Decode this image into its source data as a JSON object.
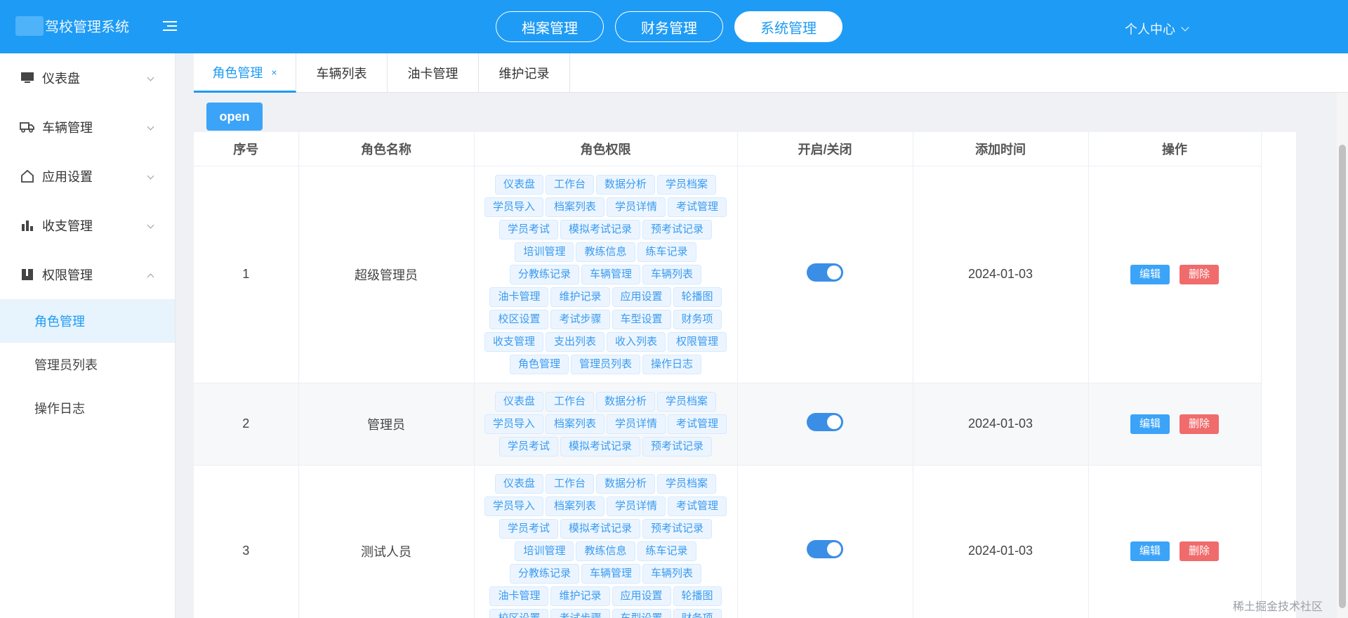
{
  "header": {
    "title": "驾校管理系统",
    "top_tabs": [
      {
        "label": "档案管理",
        "active": false
      },
      {
        "label": "财务管理",
        "active": false
      },
      {
        "label": "系统管理",
        "active": true
      }
    ],
    "user_center": "个人中心",
    "accent_color": "#1e9bf5"
  },
  "sidebar": {
    "items": [
      {
        "label": "仪表盘",
        "icon": "monitor-icon"
      },
      {
        "label": "车辆管理",
        "icon": "truck-icon"
      },
      {
        "label": "应用设置",
        "icon": "home-icon"
      },
      {
        "label": "收支管理",
        "icon": "bar-chart-icon"
      },
      {
        "label": "权限管理",
        "icon": "book-icon",
        "expanded": true
      }
    ],
    "sub_items": [
      {
        "label": "角色管理",
        "active": true
      },
      {
        "label": "管理员列表",
        "active": false
      },
      {
        "label": "操作日志",
        "active": false
      }
    ]
  },
  "tabs": [
    {
      "label": "角色管理",
      "active": true,
      "closable": true,
      "close_symbol": "×"
    },
    {
      "label": "车辆列表",
      "active": false
    },
    {
      "label": "油卡管理",
      "active": false
    },
    {
      "label": "维护记录",
      "active": false
    }
  ],
  "open_button": "open",
  "table": {
    "columns": [
      "序号",
      "角色名称",
      "角色权限",
      "开启/关闭",
      "添加时间",
      "操作"
    ],
    "rows": [
      {
        "index": "1",
        "name": "超级管理员",
        "permissions": [
          "仪表盘",
          "工作台",
          "数据分析",
          "学员档案",
          "学员导入",
          "档案列表",
          "学员详情",
          "考试管理",
          "学员考试",
          "模拟考试记录",
          "预考试记录",
          "培训管理",
          "教练信息",
          "练车记录",
          "分教练记录",
          "车辆管理",
          "车辆列表",
          "油卡管理",
          "维护记录",
          "应用设置",
          "轮播图",
          "校区设置",
          "考试步骤",
          "车型设置",
          "财务项",
          "收支管理",
          "支出列表",
          "收入列表",
          "权限管理",
          "角色管理",
          "管理员列表",
          "操作日志"
        ],
        "enabled": true,
        "date": "2024-01-03"
      },
      {
        "index": "2",
        "name": "管理员",
        "permissions": [
          "仪表盘",
          "工作台",
          "数据分析",
          "学员档案",
          "学员导入",
          "档案列表",
          "学员详情",
          "考试管理",
          "学员考试",
          "模拟考试记录",
          "预考试记录"
        ],
        "enabled": true,
        "date": "2024-01-03"
      },
      {
        "index": "3",
        "name": "测试人员",
        "permissions": [
          "仪表盘",
          "工作台",
          "数据分析",
          "学员档案",
          "学员导入",
          "档案列表",
          "学员详情",
          "考试管理",
          "学员考试",
          "模拟考试记录",
          "预考试记录",
          "培训管理",
          "教练信息",
          "练车记录",
          "分教练记录",
          "车辆管理",
          "车辆列表",
          "油卡管理",
          "维护记录",
          "应用设置",
          "轮播图",
          "校区设置",
          "考试步骤",
          "车型设置",
          "财务项"
        ],
        "enabled": true,
        "date": "2024-01-03"
      }
    ],
    "edit_label": "编辑",
    "delete_label": "删除"
  },
  "watermark": "稀土掘金技术社区"
}
